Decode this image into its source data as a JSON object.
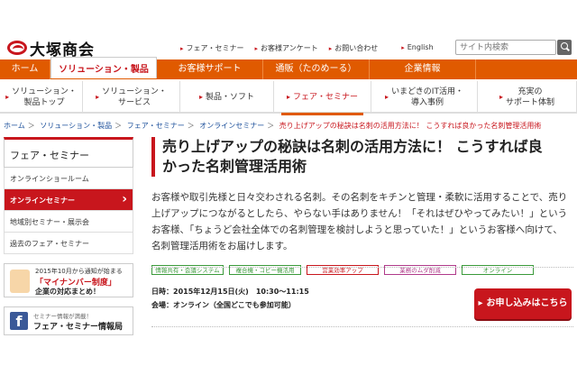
{
  "header": {
    "logo_text": "大塚商会",
    "util_links": [
      "フェア・セミナー",
      "お客様アンケート",
      "お問い合わせ",
      "English"
    ],
    "search_placeholder": "サイト内検索"
  },
  "mainnav": [
    {
      "label": "ホーム"
    },
    {
      "label": "ソリューション・製品"
    },
    {
      "label": "お客様サポート"
    },
    {
      "label": "通販（たのめーる）"
    },
    {
      "label": "企業情報"
    }
  ],
  "subnav": [
    {
      "line1": "ソリューション・",
      "line2": "製品トップ"
    },
    {
      "line1": "ソリューション・",
      "line2": "サービス"
    },
    {
      "line1": "製品・ソフト",
      "line2": ""
    },
    {
      "line1": "フェア・セミナー",
      "line2": ""
    },
    {
      "line1": "いまどきのIT活用・",
      "line2": "導入事例"
    },
    {
      "line1": "充実の",
      "line2": "サポート体制"
    }
  ],
  "breadcrumb": [
    "ホーム",
    "ソリューション・製品",
    "フェア・セミナー",
    "オンラインセミナー"
  ],
  "breadcrumb_current": "売り上げアップの秘訣は名刺の活用方法に！ こうすれば良かった名刺管理活用術",
  "sidebar": {
    "title": "フェア・セミナー",
    "items": [
      "オンラインショールーム",
      "オンラインセミナー",
      "地域別セミナー・展示会",
      "過去のフェア・セミナー"
    ],
    "banner1": {
      "line1": "2015年10月から通知が始まる",
      "line2": "「マイナンバー制度」",
      "line3": "企業の対応まとめ！"
    },
    "banner2": {
      "line1": "セミナー情報が満載！",
      "line2": "フェア・セミナー情報局"
    }
  },
  "main": {
    "title_line1": "売り上げアップの秘訣は名刺の活用方法に！ こうすれば良",
    "title_line2": "かった名刺管理活用術",
    "desc_line1": "お客様や取引先様と日々交わされる名刺。その名刺をキチンと管理・柔軟に活用することで、売り",
    "desc_line2": "上げアップにつながるとしたら、やらない手はありません！「それはぜひやってみたい！」という",
    "desc_line3": "お客様、「ちょうど会社全体での名刺管理を検討しようと思っていた！」というお客様へ向けて、",
    "desc_line4": "名刺管理活用術をお届けします。",
    "tags": [
      {
        "label": "情報共有・会議システム",
        "color": "#3a9a3a"
      },
      {
        "label": "複合機・コピー機活用",
        "color": "#3a9a3a"
      },
      {
        "label": "営業効率アップ",
        "color": "#c8161d"
      },
      {
        "label": "業務のムダ削減",
        "color": "#b03a8a"
      },
      {
        "label": "オンライン",
        "color": "#3a9a3a"
      }
    ],
    "date": "日時：2015年12月15日(火)　10:30～11:15",
    "venue": "会場：オンライン（全国どこでも参加可能）",
    "apply_label": "お申し込みはこちら"
  },
  "colors": {
    "brand_red": "#c8161d",
    "nav_orange": "#e05a00"
  }
}
